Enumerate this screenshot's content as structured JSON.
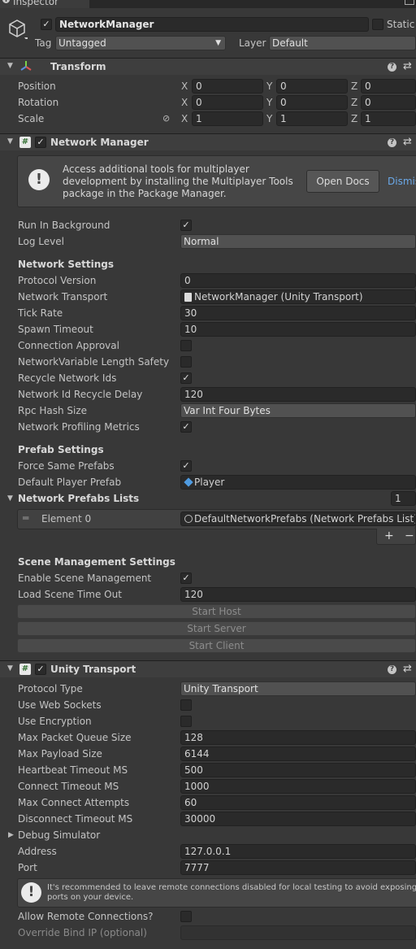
{
  "window": {
    "tab_title": "Inspector"
  },
  "object": {
    "name": "NetworkManager",
    "static_label": "Static",
    "tag_label": "Tag",
    "tag_value": "Untagged",
    "layer_label": "Layer",
    "layer_value": "Default"
  },
  "transform": {
    "title": "Transform",
    "rows": [
      {
        "label": "Position",
        "x": "0",
        "y": "0",
        "z": "0"
      },
      {
        "label": "Rotation",
        "x": "0",
        "y": "0",
        "z": "0"
      },
      {
        "label": "Scale",
        "x": "1",
        "y": "1",
        "z": "1"
      }
    ],
    "axis": {
      "x": "X",
      "y": "Y",
      "z": "Z"
    }
  },
  "network_manager": {
    "title": "Network Manager",
    "info": {
      "text": "Access additional tools for multiplayer development by installing the Multiplayer Tools package in the Package Manager.",
      "open_docs": "Open Docs",
      "dismiss": "Dismiss"
    },
    "run_in_background": {
      "label": "Run In Background",
      "checked": true
    },
    "log_level": {
      "label": "Log Level",
      "value": "Normal"
    },
    "network_settings_header": "Network Settings",
    "protocol_version": {
      "label": "Protocol Version",
      "value": "0"
    },
    "network_transport": {
      "label": "Network Transport",
      "value": "NetworkManager (Unity Transport)"
    },
    "tick_rate": {
      "label": "Tick Rate",
      "value": "30"
    },
    "spawn_timeout": {
      "label": "Spawn Timeout",
      "value": "10"
    },
    "connection_approval": {
      "label": "Connection Approval",
      "checked": false
    },
    "nv_length_safety": {
      "label": "NetworkVariable Length Safety",
      "checked": false
    },
    "recycle_ids": {
      "label": "Recycle Network Ids",
      "checked": true
    },
    "id_recycle_delay": {
      "label": "Network Id Recycle Delay",
      "value": "120"
    },
    "rpc_hash_size": {
      "label": "Rpc Hash Size",
      "value": "Var Int Four Bytes"
    },
    "profiling_metrics": {
      "label": "Network Profiling Metrics",
      "checked": true
    },
    "prefab_settings_header": "Prefab Settings",
    "force_same_prefabs": {
      "label": "Force Same Prefabs",
      "checked": true
    },
    "default_player_prefab": {
      "label": "Default Player Prefab",
      "value": "Player"
    },
    "prefabs_lists": {
      "label": "Network Prefabs Lists",
      "count": "1",
      "element_label": "Element 0",
      "element_value": "DefaultNetworkPrefabs (Network Prefabs List)",
      "add": "+",
      "remove": "−"
    },
    "scene_mgmt_header": "Scene Management Settings",
    "enable_scene_mgmt": {
      "label": "Enable Scene Management",
      "checked": true
    },
    "load_scene_timeout": {
      "label": "Load Scene Time Out",
      "value": "120"
    },
    "buttons": {
      "start_host": "Start Host",
      "start_server": "Start Server",
      "start_client": "Start Client"
    }
  },
  "unity_transport": {
    "title": "Unity Transport",
    "protocol_type": {
      "label": "Protocol Type",
      "value": "Unity Transport"
    },
    "use_web_sockets": {
      "label": "Use Web Sockets",
      "checked": false
    },
    "use_encryption": {
      "label": "Use Encryption",
      "checked": false
    },
    "max_packet_queue": {
      "label": "Max Packet Queue Size",
      "value": "128"
    },
    "max_payload": {
      "label": "Max Payload Size",
      "value": "6144"
    },
    "heartbeat_timeout": {
      "label": "Heartbeat Timeout MS",
      "value": "500"
    },
    "connect_timeout": {
      "label": "Connect Timeout MS",
      "value": "1000"
    },
    "max_connect_attempts": {
      "label": "Max Connect Attempts",
      "value": "60"
    },
    "disconnect_timeout": {
      "label": "Disconnect Timeout MS",
      "value": "30000"
    },
    "debug_simulator": "Debug Simulator",
    "address": {
      "label": "Address",
      "value": "127.0.0.1"
    },
    "port": {
      "label": "Port",
      "value": "7777"
    },
    "remote_warning": "It's recommended to leave remote connections disabled for local testing to avoid exposing ports on your device.",
    "allow_remote": {
      "label": "Allow Remote Connections?",
      "checked": false
    },
    "override_bind_ip": {
      "label": "Override Bind IP (optional)",
      "value": ""
    }
  },
  "colors": {
    "accent": "#3a79bb",
    "link": "#6aa8e8",
    "background": "#383838",
    "field": "#2a2a2a"
  }
}
